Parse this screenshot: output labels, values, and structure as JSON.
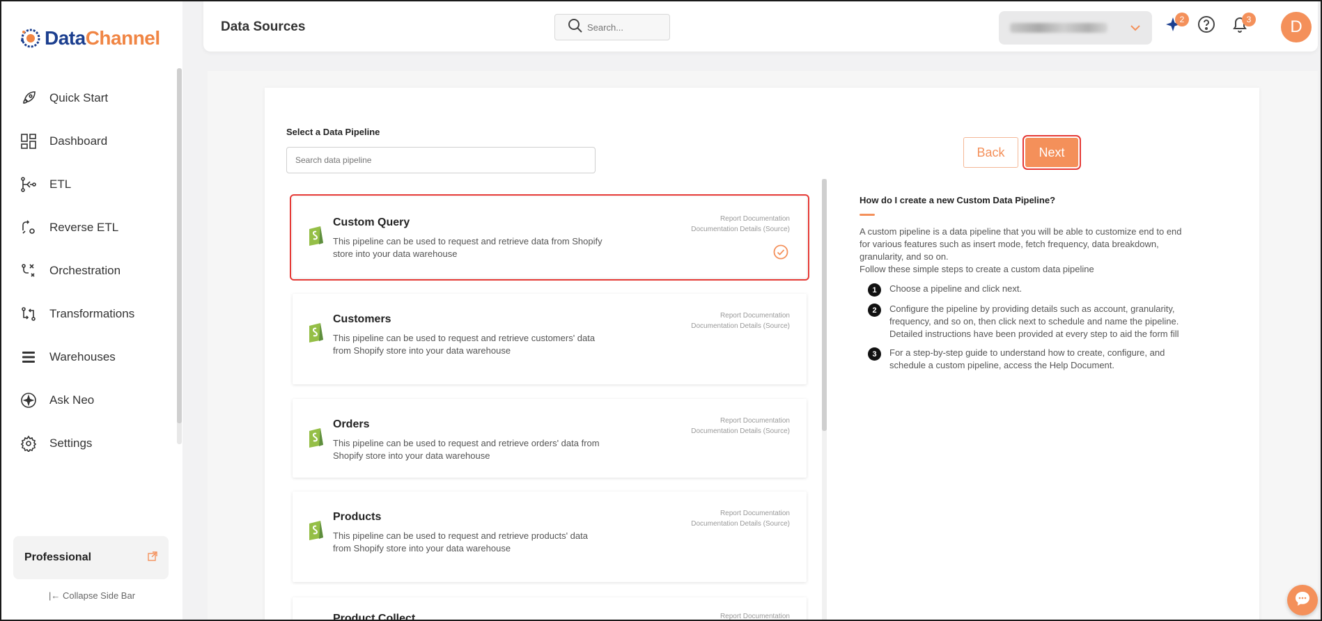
{
  "brand": {
    "part1": "Data",
    "part2": "Channel"
  },
  "sidebar": {
    "items": [
      {
        "label": "Quick Start",
        "icon": "rocket-icon"
      },
      {
        "label": "Dashboard",
        "icon": "dashboard-icon"
      },
      {
        "label": "ETL",
        "icon": "etl-icon"
      },
      {
        "label": "Reverse ETL",
        "icon": "reverse-etl-icon"
      },
      {
        "label": "Orchestration",
        "icon": "orchestration-icon"
      },
      {
        "label": "Transformations",
        "icon": "transformations-icon"
      },
      {
        "label": "Warehouses",
        "icon": "warehouses-icon"
      },
      {
        "label": "Ask Neo",
        "icon": "sparkle-icon"
      },
      {
        "label": "Settings",
        "icon": "gear-icon"
      }
    ],
    "plan": "Professional",
    "collapse": "Collapse Side Bar"
  },
  "header": {
    "title": "Data Sources",
    "search_placeholder": "Search...",
    "ai_badge": "2",
    "notif_badge": "3",
    "avatar_initial": "D"
  },
  "main": {
    "select_label": "Select a Data Pipeline",
    "search_placeholder": "Search data pipeline",
    "back_label": "Back",
    "next_label": "Next",
    "link_report": "Report Documentation",
    "link_details": "Documentation Details (Source)",
    "pipelines": [
      {
        "name": "Custom Query",
        "desc": "This pipeline can be used to request and retrieve data from Shopify store into your data warehouse",
        "selected": true
      },
      {
        "name": "Customers",
        "desc": "This pipeline can be used to request and retrieve customers' data from Shopify store into your data warehouse",
        "selected": false
      },
      {
        "name": "Orders",
        "desc": "This pipeline can be used to request and retrieve orders' data from Shopify store into your data warehouse",
        "selected": false
      },
      {
        "name": "Products",
        "desc": "This pipeline can be used to request and retrieve products' data from Shopify store into your data warehouse",
        "selected": false
      },
      {
        "name": "Product Collect",
        "desc": "",
        "selected": false
      }
    ]
  },
  "help": {
    "title": "How do I create a new Custom Data Pipeline?",
    "intro": "A custom pipeline is a data pipeline that you will be able to customize end to end for various features such as insert mode, fetch frequency, data breakdown, granularity, and so on.",
    "follow": "Follow these simple steps to create a custom data pipeline",
    "steps": [
      {
        "num": "1",
        "text": "Choose a pipeline and click next."
      },
      {
        "num": "2",
        "text": "Configure the pipeline by providing details such as account, granularity, frequency, and so on, then click next to schedule and name the pipeline. Detailed instructions have been provided at every step to aid the form fill"
      },
      {
        "num": "3",
        "text": "For a step-by-step guide to understand how to create, configure, and schedule a custom pipeline, access the Help Document."
      }
    ]
  },
  "colors": {
    "accent": "#f4905a",
    "brand_blue": "#1c3f8f",
    "highlight": "#e53935"
  }
}
